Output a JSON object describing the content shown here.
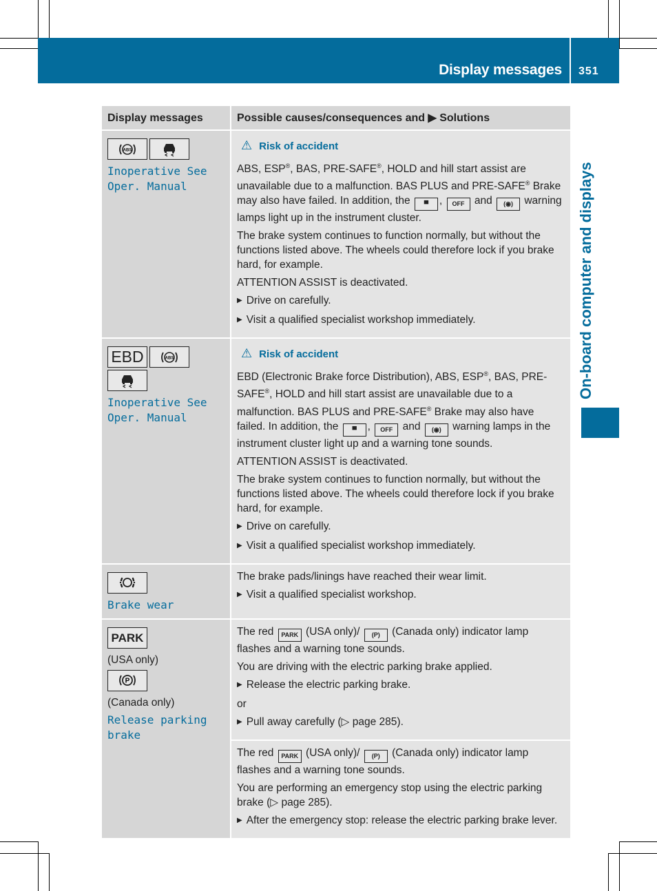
{
  "header": {
    "title": "Display messages",
    "page_number": "351"
  },
  "side_tab": {
    "title": "On-board computer and displays"
  },
  "table": {
    "columns": [
      "Display messages",
      "Possible causes/consequences and ▶ Solutions"
    ],
    "rows": [
      {
        "icons": [
          "abs-icon",
          "esp-icon"
        ],
        "message": "Inoperative See Oper. Manual",
        "warning": "Risk of accident",
        "paragraphs": [
          "ABS, ESP®, BAS, PRE-SAFE®, HOLD and hill start assist are unavailable due to a malfunction. BAS PLUS and PRE-SAFE® Brake may also have failed. In addition, the [esp], [esp-off] and [abs] warning lamps light up in the instrument cluster.",
          "The brake system continues to function normally, but without the functions listed above. The wheels could therefore lock if you brake hard, for example.",
          "ATTENTION ASSIST is deactivated."
        ],
        "steps": [
          "Drive on carefully.",
          "Visit a qualified specialist workshop immediately."
        ]
      },
      {
        "icons": [
          "ebd-icon",
          "abs-icon",
          "esp-icon"
        ],
        "icon_ebd_label": "EBD",
        "message": "Inoperative See Oper. Manual",
        "warning": "Risk of accident",
        "paragraphs": [
          "EBD (Electronic Brake force Distribution), ABS, ESP®, BAS, PRE-SAFE®, HOLD and hill start assist are unavailable due to a malfunction. BAS PLUS and PRE-SAFE® Brake may also have failed. In addition, the [esp], [esp-off] and [abs] warning lamps in the instrument cluster light up and a warning tone sounds.",
          "ATTENTION ASSIST is deactivated.",
          "The brake system continues to function normally, but without the functions listed above. The wheels could therefore lock if you brake hard, for example."
        ],
        "steps": [
          "Drive on carefully.",
          "Visit a qualified specialist workshop immediately."
        ]
      },
      {
        "icons": [
          "brake-wear-icon"
        ],
        "message": "Brake wear",
        "paragraphs": [
          "The brake pads/linings have reached their wear limit."
        ],
        "steps": [
          "Visit a qualified specialist workshop."
        ]
      },
      {
        "icons": [
          "park-icon",
          "parking-brake-p-icon"
        ],
        "park_label": "PARK",
        "usa_note": "(USA only)",
        "canada_note": "(Canada only)",
        "message": "Release parking brake",
        "sub": [
          {
            "p1": "The red [PARK] (USA only)/ [P] (Canada only) indicator lamp flashes and a warning tone sounds.",
            "p2": "You are driving with the electric parking brake applied.",
            "step1": "Release the electric parking brake.",
            "or": "or",
            "step2": "Pull away carefully (▷ page 285)."
          },
          {
            "p1": "The red [PARK] (USA only)/ [P] (Canada only) indicator lamp flashes and a warning tone sounds.",
            "p2": "You are performing an emergency stop using the electric parking brake (▷ page 285).",
            "step1": "After the emergency stop: release the electric parking brake lever."
          }
        ]
      }
    ]
  },
  "inline_text": {
    "r1a": "ABS, ESP",
    "r1b": ", BAS, PRE-SAFE",
    "r1c": ", HOLD and hill start assist are unavailable due to a malfunction. BAS PLUS and PRE-SAFE",
    "r1d": " Brake may also have failed. In addition, the",
    "r1e": "warning lamps light up in the instrument cluster.",
    "r2a": "EBD (Electronic Brake force Distribution), ABS, ESP",
    "r2b": ", BAS, PRE-SAFE",
    "r2c": ", HOLD and hill start assist are unavailable due to a malfunction. BAS PLUS and PRE-SAFE",
    "r2d": " Brake may also have failed. In addition, the",
    "r2e": "warning lamps in the instrument cluster light up and a warning tone sounds.",
    "reg": "®",
    "comma": ",",
    "and": "and",
    "the_red": "The red",
    "usa_only_slash": "(USA only)/",
    "canada_lamp": "(Canada only) indicator lamp flashes and a warning tone sounds.",
    "park_small": "PARK"
  }
}
